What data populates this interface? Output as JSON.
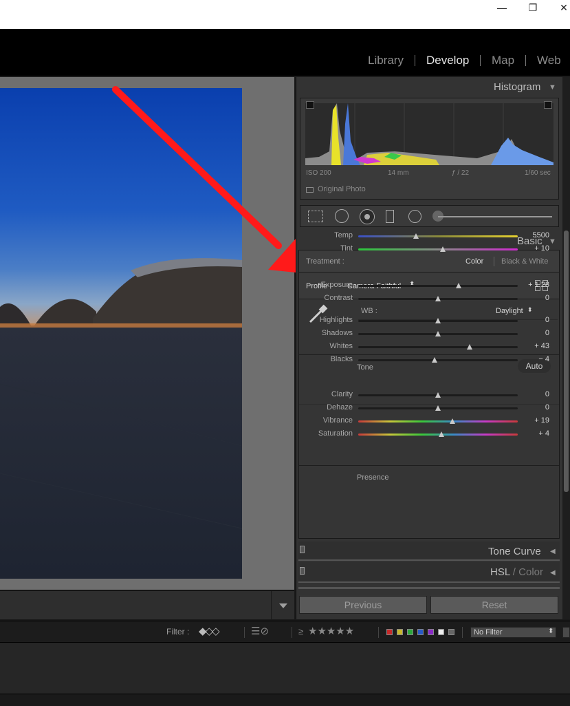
{
  "window": {
    "minimize_icon": "minimize-icon",
    "maximize_icon": "maximize-icon",
    "close_icon": "close-icon"
  },
  "modules": [
    "Library",
    "Develop",
    "Map",
    "Web"
  ],
  "active_module": "Develop",
  "histogram": {
    "title": "Histogram",
    "iso": "ISO 200",
    "focal": "14 mm",
    "aperture": "ƒ / 22",
    "shutter": "1/60 sec",
    "original_photo": "Original Photo"
  },
  "basic": {
    "title": "Basic",
    "treatment_label": "Treatment :",
    "treatment_color": "Color",
    "treatment_bw": "Black & White",
    "profile_label": "Profile :",
    "profile_value": "Camera Faithful",
    "wb_label": "WB :",
    "wb_value": "Daylight",
    "tone_label": "Tone",
    "auto_label": "Auto",
    "presence_label": "Presence",
    "sliders": [
      {
        "label": "Temp",
        "value": "5500",
        "pos": 0.36
      },
      {
        "label": "Tint",
        "value": "+ 10",
        "pos": 0.53
      },
      {
        "label": "Exposure",
        "value": "+ 1.28",
        "pos": 0.63
      },
      {
        "label": "Contrast",
        "value": "0",
        "pos": 0.5
      },
      {
        "label": "Highlights",
        "value": "0",
        "pos": 0.5
      },
      {
        "label": "Shadows",
        "value": "0",
        "pos": 0.5
      },
      {
        "label": "Whites",
        "value": "+ 43",
        "pos": 0.7
      },
      {
        "label": "Blacks",
        "value": "− 4",
        "pos": 0.48
      },
      {
        "label": "Clarity",
        "value": "0",
        "pos": 0.5
      },
      {
        "label": "Dehaze",
        "value": "0",
        "pos": 0.5
      },
      {
        "label": "Vibrance",
        "value": "+ 19",
        "pos": 0.59
      },
      {
        "label": "Saturation",
        "value": "+ 4",
        "pos": 0.52
      }
    ]
  },
  "tone_curve": {
    "title": "Tone Curve"
  },
  "hsl": {
    "title_a": "HSL",
    "sep": " / ",
    "title_b": "Color"
  },
  "buttons": {
    "previous": "Previous",
    "reset": "Reset"
  },
  "filter": {
    "label": "Filter :",
    "gte": "≥",
    "stars": "★★★★★",
    "no_filter": "No Filter"
  },
  "colors": {
    "accent_arrow": "#ff1a1a",
    "panel_bg": "#333333"
  }
}
